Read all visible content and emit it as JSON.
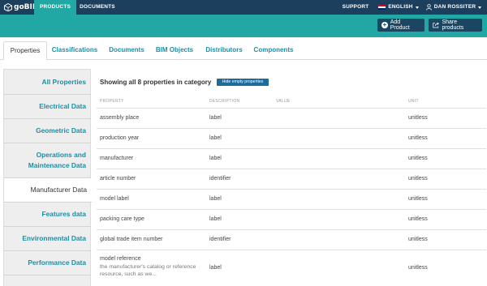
{
  "nav": {
    "logo": "goBIM",
    "products": "PRODUCTS",
    "documents": "DOCUMENTS",
    "support": "SUPPORT",
    "language": "ENGLISH",
    "user": "DAN ROSSITER"
  },
  "actions": {
    "add_product": "Add Product",
    "share_products": "Share products"
  },
  "tabs": [
    {
      "label": "Properties",
      "active": true
    },
    {
      "label": "Classifications",
      "active": false
    },
    {
      "label": "Documents",
      "active": false
    },
    {
      "label": "BIM Objects",
      "active": false
    },
    {
      "label": "Distributors",
      "active": false
    },
    {
      "label": "Components",
      "active": false
    }
  ],
  "sidebar": {
    "items": [
      {
        "line1": "All Properties",
        "line2": "",
        "active": false
      },
      {
        "line1": "Electrical Data",
        "line2": "",
        "active": false
      },
      {
        "line1": "Geometric Data",
        "line2": "",
        "active": false
      },
      {
        "line1": "Operations and",
        "line2": "Maintenance Data",
        "active": false
      },
      {
        "line1": "Manufacturer Data",
        "line2": "",
        "active": true
      },
      {
        "line1": "Features data",
        "line2": "",
        "active": false
      },
      {
        "line1": "Environmental Data",
        "line2": "",
        "active": false
      },
      {
        "line1": "Performance Data",
        "line2": "",
        "active": false
      }
    ]
  },
  "main": {
    "heading": "Showing all 8 properties in category",
    "hide_button": "Hide empty properties",
    "columns": {
      "property": "PROPERTY",
      "description": "DESCRIPTION",
      "value": "VALUE",
      "unit": "UNIT"
    },
    "rows": [
      {
        "property": "assembly place",
        "description": "label",
        "value": "",
        "unit": "unitless"
      },
      {
        "property": "production year",
        "description": "label",
        "value": "",
        "unit": "unitless"
      },
      {
        "property": "manufacturer",
        "description": "label",
        "value": "",
        "unit": "unitless"
      },
      {
        "property": "article number",
        "description": "identifier",
        "value": "",
        "unit": "unitless"
      },
      {
        "property": "model label",
        "description": "label",
        "value": "",
        "unit": "unitless"
      },
      {
        "property": "packing care type",
        "description": "label",
        "value": "",
        "unit": "unitless"
      },
      {
        "property": "global trade item number",
        "description": "identifier",
        "value": "",
        "unit": "unitless"
      },
      {
        "property": "model reference",
        "subtext1": "the manufacturer's catalog or reference",
        "subtext2": "resource, such as we...",
        "description": "label",
        "value": "",
        "unit": "unitless"
      }
    ]
  },
  "colors": {
    "nav_bg": "#1d3f5e",
    "accent": "#21a8a5",
    "button_bg": "#1b4661",
    "link": "#1a8fa5"
  }
}
